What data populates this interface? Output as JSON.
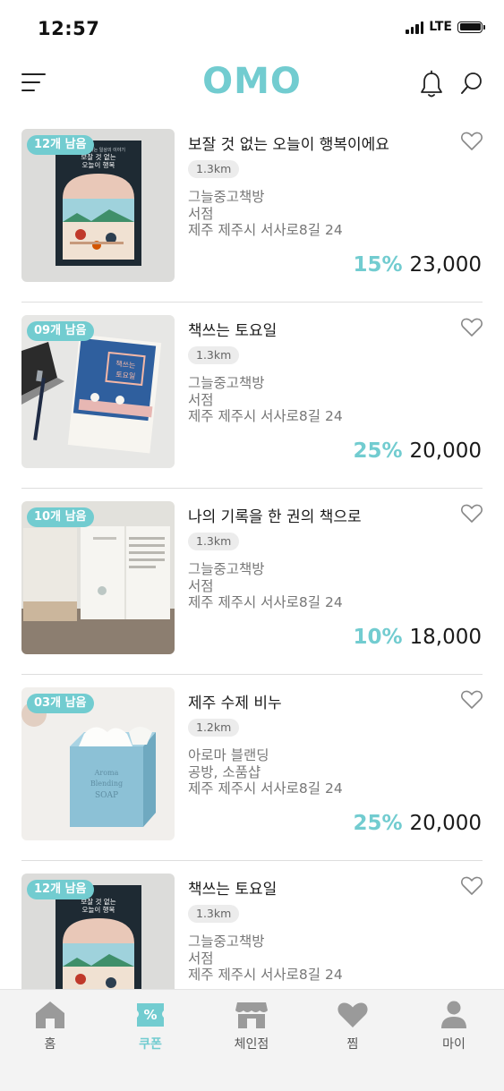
{
  "status_bar": {
    "time": "12:57",
    "network": "LTE"
  },
  "header": {
    "logo": "OMO"
  },
  "colors": {
    "accent": "#72ccd0",
    "icon_gray": "#9a9a9a"
  },
  "items": [
    {
      "stock": "12개 남음",
      "title": "보잘 것 없는 오늘이 행복이에요",
      "distance": "1.3km",
      "shop": "그늘중고책방",
      "category": "서점",
      "address": "제주 제주시 서사로8길 24",
      "discount": "15%",
      "price": "23,000"
    },
    {
      "stock": "09개 남음",
      "title": "책쓰는 토요일",
      "distance": "1.3km",
      "shop": "그늘중고책방",
      "category": "서점",
      "address": "제주 제주시 서사로8길 24",
      "discount": "25%",
      "price": "20,000"
    },
    {
      "stock": "10개 남음",
      "title": "나의 기록을 한 권의 책으로",
      "distance": "1.3km",
      "shop": "그늘중고책방",
      "category": "서점",
      "address": "제주 제주시 서사로8길 24",
      "discount": "10%",
      "price": "18,000"
    },
    {
      "stock": "03개 남음",
      "title": "제주 수제 비누",
      "distance": "1.2km",
      "shop": "아로마 블랜딩",
      "category": "공방, 소품샵",
      "address": "제주 제주시 서사로8길 24",
      "discount": "25%",
      "price": "20,000"
    },
    {
      "stock": "12개 남음",
      "title": "책쓰는 토요일",
      "distance": "1.3km",
      "shop": "그늘중고책방",
      "category": "서점",
      "address": "제주 제주시 서사로8길 24",
      "discount": "",
      "price": ""
    }
  ],
  "thumb_text": {
    "book1_title": "보잘 것 없는 오늘이 행복이에요",
    "book2_title": "책쓰는 토요일",
    "soap": "Aroma Blending SOAP"
  },
  "tabs": [
    {
      "label": "홈",
      "icon": "home-icon"
    },
    {
      "label": "쿠폰",
      "icon": "coupon-icon"
    },
    {
      "label": "체인점",
      "icon": "store-icon"
    },
    {
      "label": "찜",
      "icon": "heart-icon"
    },
    {
      "label": "마이",
      "icon": "person-icon"
    }
  ]
}
